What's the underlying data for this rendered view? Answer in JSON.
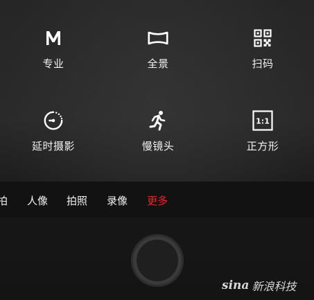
{
  "modes": [
    {
      "label": "专业",
      "icon": "m-letter-icon"
    },
    {
      "label": "全景",
      "icon": "panorama-icon"
    },
    {
      "label": "扫码",
      "icon": "qr-code-icon"
    },
    {
      "label": "延时摄影",
      "icon": "timelapse-icon"
    },
    {
      "label": "慢镜头",
      "icon": "running-man-icon"
    },
    {
      "label": "正方形",
      "icon": "square-ratio-icon",
      "icon_text": "1:1"
    }
  ],
  "tabs": [
    {
      "label": "拍"
    },
    {
      "label": "人像"
    },
    {
      "label": "拍照"
    },
    {
      "label": "录像"
    },
    {
      "label": "更多",
      "active": true
    }
  ],
  "colors": {
    "active_tab": "#e8262e",
    "text": "#f2f2f2",
    "background": "#1c1c1c"
  },
  "watermark": {
    "brand": "sina",
    "text": "新浪科技"
  }
}
